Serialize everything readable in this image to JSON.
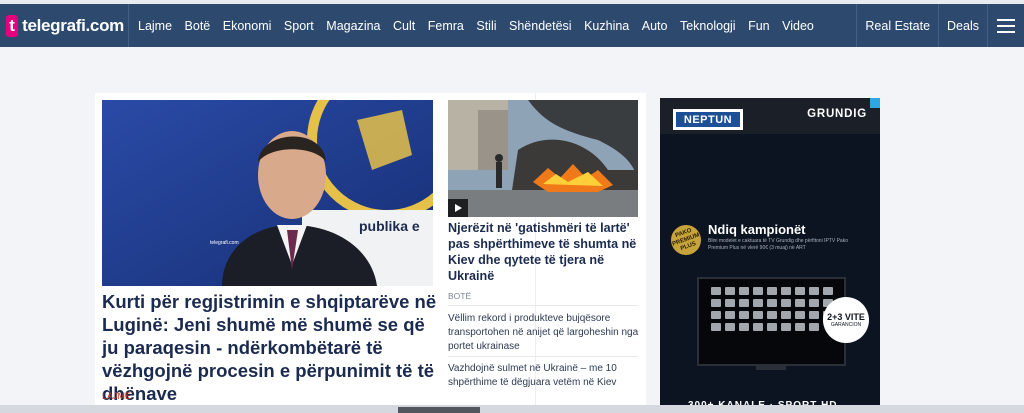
{
  "header": {
    "logo_mark": "t",
    "logo_text": "telegrafi.com",
    "nav": [
      "Lajme",
      "Botë",
      "Ekonomi",
      "Sport",
      "Magazina",
      "Cult",
      "Femra",
      "Stili",
      "Shëndetësi",
      "Kuzhina",
      "Auto",
      "Teknologji",
      "Fun",
      "Video"
    ],
    "right": [
      "Real Estate",
      "Deals"
    ]
  },
  "hero": {
    "title": "Kurti për regjistrimin e shqiptarëve në Luginë: Jeni shumë më shumë se që ju paraqesin - ndërkombëtarë të vëzhgojnë procesin e përpunimit të të dhënave",
    "category": "LAJME",
    "watermark": "telegrafi.com",
    "flag_text": "publika e"
  },
  "side": {
    "title": "Njerëzit në 'gatishmëri të lartë' pas shpërthimeve të shumta në Kiev dhe qytete të tjera në Ukrainë",
    "category": "BOTË",
    "related": [
      "Vëllim rekord i produkteve bujqësore transportohen në anijet që largoheshin nga portet ukrainase",
      "Vazhdojnë sulmet në Ukrainë – me 10 shpërthime të dëgjuara vetëm në Kiev"
    ]
  },
  "ad": {
    "brand_left": "NEPTUN",
    "brand_right": "GRUNDIG",
    "badge": "PAKO PREMIUM PLUS",
    "headline": "Ndiq kampionët",
    "subtext": "Blini modelet e caktuara të TV Grundig dhe përfitoni IPTV Pako Premium Plus në vlerë 90€ (3 muaj) në ART",
    "warranty_big": "2+3 VITE",
    "warranty_small": "GARANCION",
    "bottom": "300+ KANALE · SPORT HD"
  }
}
